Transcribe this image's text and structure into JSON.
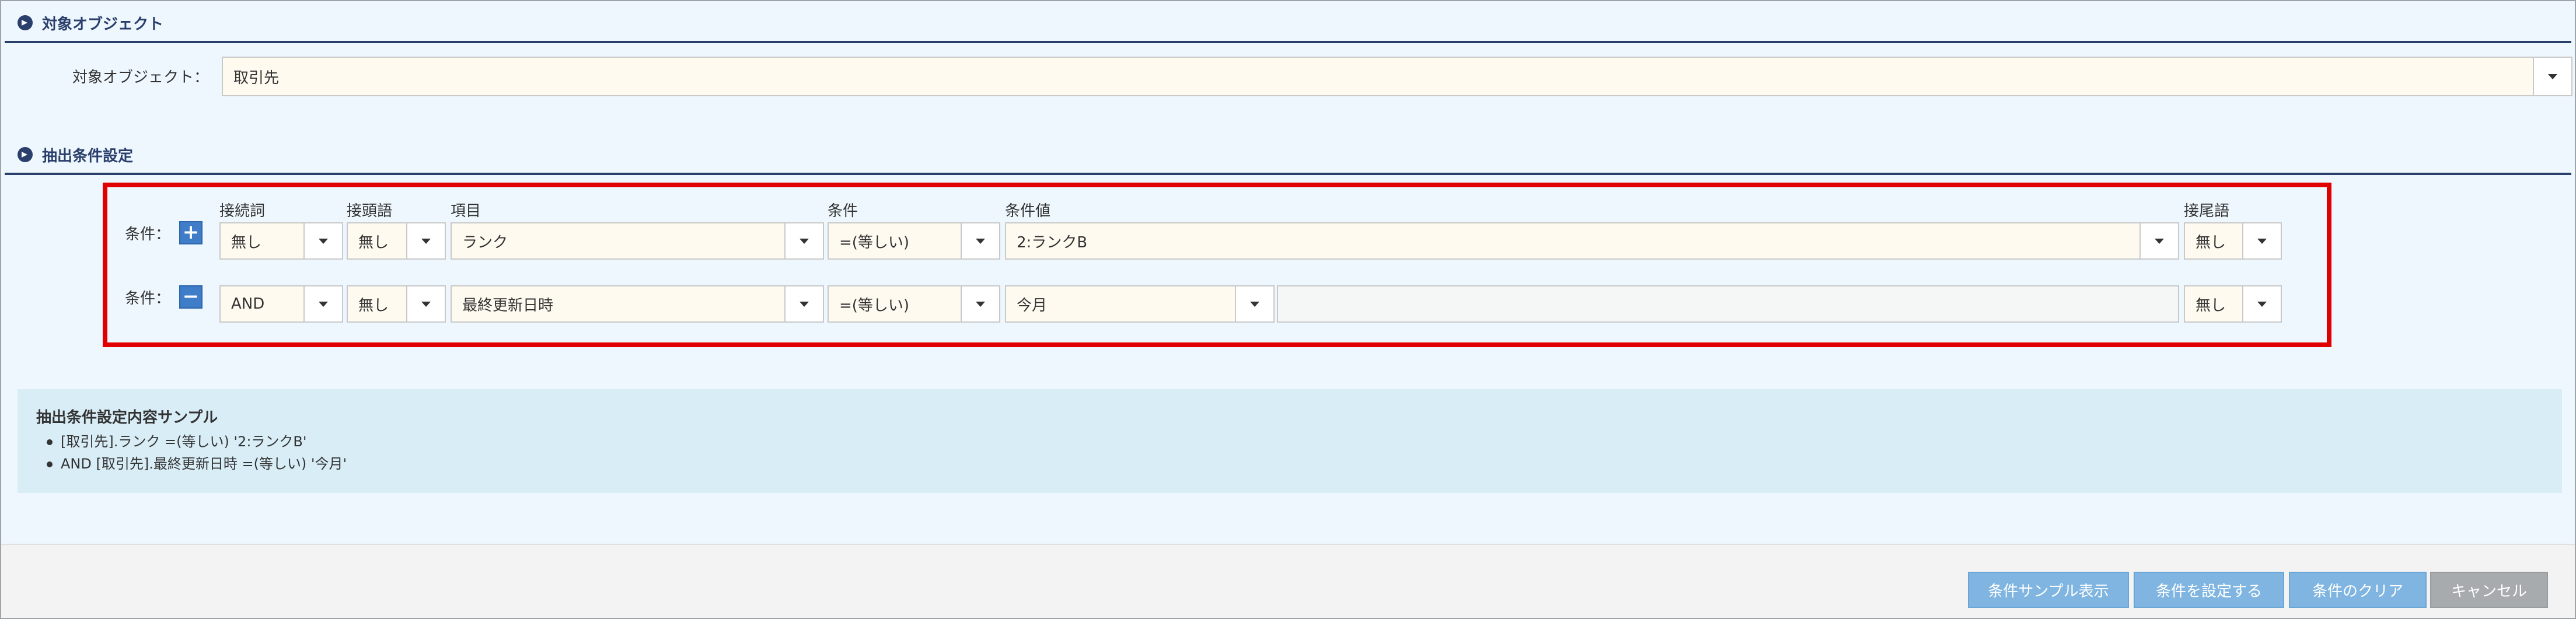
{
  "section1": {
    "title": "対象オブジェクト",
    "label": "対象オブジェクト：",
    "value": "取引先"
  },
  "section2": {
    "title": "抽出条件設定"
  },
  "headers": {
    "connector": "接続詞",
    "prefix": "接頭語",
    "item": "項目",
    "condition": "条件",
    "value": "条件値",
    "suffix": "接尾語"
  },
  "rows": [
    {
      "label": "条件：",
      "toggle": "+",
      "connector": "無し",
      "prefix": "無し",
      "item": "ランク",
      "condition": "=(等しい)",
      "value": "2:ランクB",
      "extra": "",
      "suffix": "無し"
    },
    {
      "label": "条件：",
      "toggle": "−",
      "connector": "AND",
      "prefix": "無し",
      "item": "最終更新日時",
      "condition": "=(等しい)",
      "value": "今月",
      "extra": "",
      "suffix": "無し"
    }
  ],
  "sample": {
    "title": "抽出条件設定内容サンプル",
    "lines": [
      "[取引先].ランク =(等しい) '2:ランクB'",
      "AND [取引先].最終更新日時 =(等しい) '今月'"
    ]
  },
  "buttons": {
    "show_sample": "条件サンプル表示",
    "set": "条件を設定する",
    "clear": "条件のクリア",
    "cancel": "キャンセル"
  },
  "colors": {
    "accent": "#2b3f6c",
    "highlight": "#e10000",
    "button": "#7fb5e0",
    "button_disabled": "#a8abae"
  },
  "icons": {
    "section": "chevron-right-circle-icon",
    "add": "plus-icon",
    "remove": "minus-icon",
    "dropdown": "caret-down-icon"
  }
}
